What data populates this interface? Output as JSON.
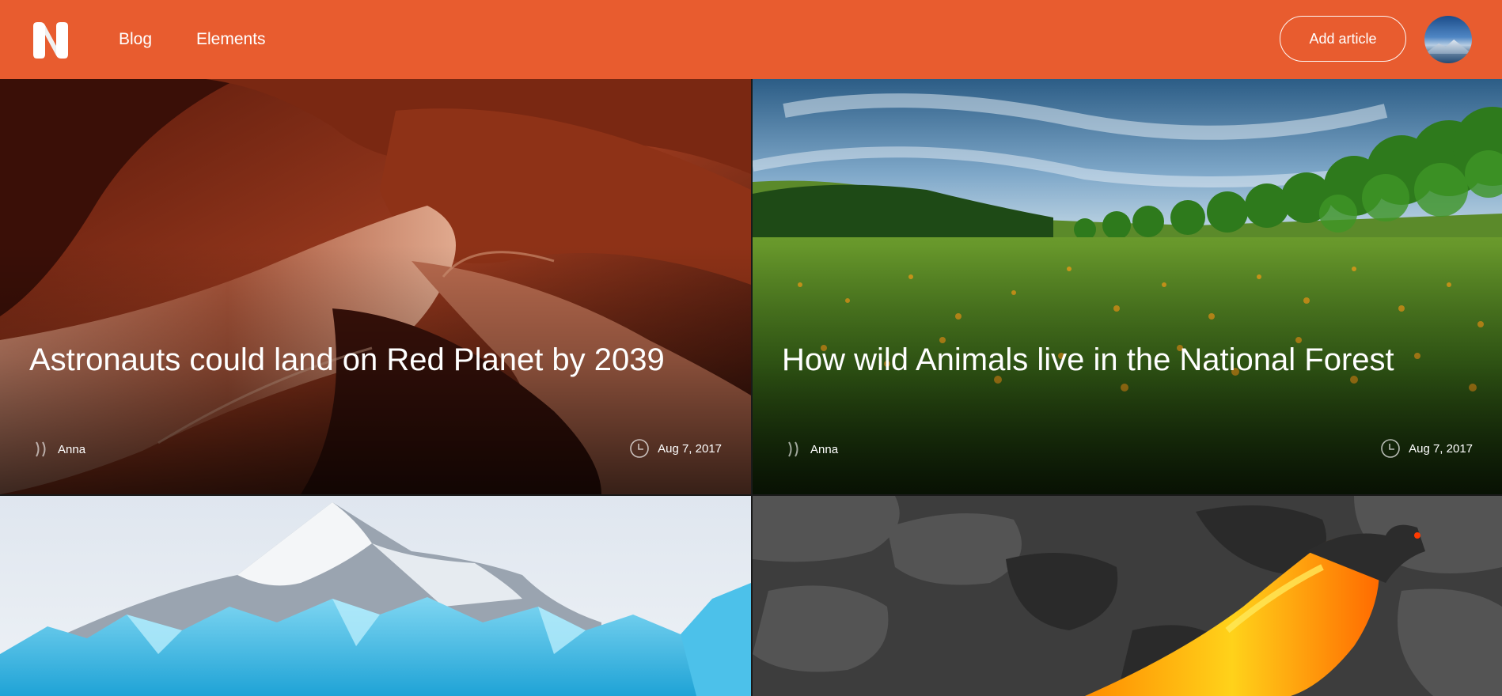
{
  "header": {
    "logo_letter": "N",
    "nav": [
      "Blog",
      "Elements"
    ],
    "add_article_label": "Add article",
    "brand_color": "#e85c2f"
  },
  "articles": [
    {
      "title": "Astronauts could land on Red Planet by 2039",
      "author": "Anna",
      "date": "Aug 7, 2017",
      "icons": [
        "author-icon",
        "clock-icon"
      ]
    },
    {
      "title": "How wild Animals live in the National Forest",
      "author": "Anna",
      "date": "Aug 7, 2017",
      "icons": [
        "author-icon",
        "clock-icon"
      ]
    },
    {
      "title": "",
      "author": "",
      "date": ""
    },
    {
      "title": "",
      "author": "",
      "date": ""
    }
  ]
}
